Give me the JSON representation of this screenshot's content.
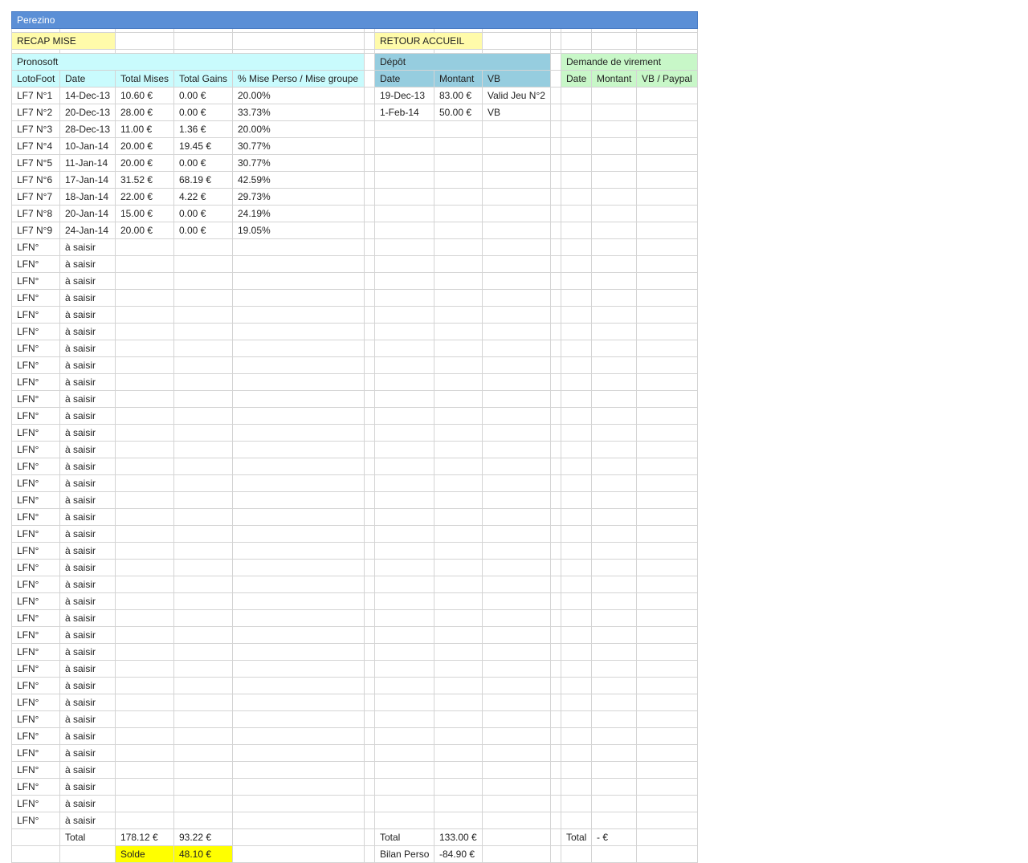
{
  "sheet_title": "Perezino",
  "buttons": {
    "recap": "RECAP MISE",
    "retour": "RETOUR ACCUEIL"
  },
  "sections": {
    "pronosoft": "Pronosoft",
    "depot": "Dépôt",
    "virement": "Demande de virement"
  },
  "columns": {
    "pronosoft": [
      "LotoFoot",
      "Date",
      "Total Mises",
      "Total Gains",
      "% Mise Perso / Mise groupe"
    ],
    "depot": [
      "Date",
      "Montant",
      "VB"
    ],
    "virement": [
      "Date",
      "Montant",
      "VB / Paypal"
    ]
  },
  "pronosoft_rows": [
    [
      "LF7 N°1",
      "14-Dec-13",
      "10.60 €",
      "0.00 €",
      "20.00%"
    ],
    [
      "LF7 N°2",
      "20-Dec-13",
      "28.00 €",
      "0.00 €",
      "33.73%"
    ],
    [
      "LF7 N°3",
      "28-Dec-13",
      "11.00 €",
      "1.36 €",
      "20.00%"
    ],
    [
      "LF7 N°4",
      "10-Jan-14",
      "20.00 €",
      "19.45 €",
      "30.77%"
    ],
    [
      "LF7 N°5",
      "11-Jan-14",
      "20.00 €",
      "0.00 €",
      "30.77%"
    ],
    [
      "LF7 N°6",
      "17-Jan-14",
      "31.52 €",
      "68.19 €",
      "42.59%"
    ],
    [
      "LF7 N°7",
      "18-Jan-14",
      "22.00 €",
      "4.22 €",
      "29.73%"
    ],
    [
      "LF7 N°8",
      "20-Jan-14",
      "15.00 €",
      "0.00 €",
      "24.19%"
    ],
    [
      "LF7 N°9",
      "24-Jan-14",
      "20.00 €",
      "0.00 €",
      "19.05%"
    ],
    [
      "LFN°",
      "à saisir",
      "",
      "",
      ""
    ],
    [
      "LFN°",
      "à saisir",
      "",
      "",
      ""
    ],
    [
      "LFN°",
      "à saisir",
      "",
      "",
      ""
    ],
    [
      "LFN°",
      "à saisir",
      "",
      "",
      ""
    ],
    [
      "LFN°",
      "à saisir",
      "",
      "",
      ""
    ],
    [
      "LFN°",
      "à saisir",
      "",
      "",
      ""
    ],
    [
      "LFN°",
      "à saisir",
      "",
      "",
      ""
    ],
    [
      "LFN°",
      "à saisir",
      "",
      "",
      ""
    ],
    [
      "LFN°",
      "à saisir",
      "",
      "",
      ""
    ],
    [
      "LFN°",
      "à saisir",
      "",
      "",
      ""
    ],
    [
      "LFN°",
      "à saisir",
      "",
      "",
      ""
    ],
    [
      "LFN°",
      "à saisir",
      "",
      "",
      ""
    ],
    [
      "LFN°",
      "à saisir",
      "",
      "",
      ""
    ],
    [
      "LFN°",
      "à saisir",
      "",
      "",
      ""
    ],
    [
      "LFN°",
      "à saisir",
      "",
      "",
      ""
    ],
    [
      "LFN°",
      "à saisir",
      "",
      "",
      ""
    ],
    [
      "LFN°",
      "à saisir",
      "",
      "",
      ""
    ],
    [
      "LFN°",
      "à saisir",
      "",
      "",
      ""
    ],
    [
      "LFN°",
      "à saisir",
      "",
      "",
      ""
    ],
    [
      "LFN°",
      "à saisir",
      "",
      "",
      ""
    ],
    [
      "LFN°",
      "à saisir",
      "",
      "",
      ""
    ],
    [
      "LFN°",
      "à saisir",
      "",
      "",
      ""
    ],
    [
      "LFN°",
      "à saisir",
      "",
      "",
      ""
    ],
    [
      "LFN°",
      "à saisir",
      "",
      "",
      ""
    ],
    [
      "LFN°",
      "à saisir",
      "",
      "",
      ""
    ],
    [
      "LFN°",
      "à saisir",
      "",
      "",
      ""
    ],
    [
      "LFN°",
      "à saisir",
      "",
      "",
      ""
    ],
    [
      "LFN°",
      "à saisir",
      "",
      "",
      ""
    ],
    [
      "LFN°",
      "à saisir",
      "",
      "",
      ""
    ],
    [
      "LFN°",
      "à saisir",
      "",
      "",
      ""
    ],
    [
      "LFN°",
      "à saisir",
      "",
      "",
      ""
    ],
    [
      "LFN°",
      "à saisir",
      "",
      "",
      ""
    ],
    [
      "LFN°",
      "à saisir",
      "",
      "",
      ""
    ],
    [
      "LFN°",
      "à saisir",
      "",
      "",
      ""
    ],
    [
      "LFN°",
      "à saisir",
      "",
      "",
      ""
    ]
  ],
  "depot_rows": [
    [
      "19-Dec-13",
      "83.00 €",
      "Valid Jeu N°2"
    ],
    [
      "1-Feb-14",
      "50.00 €",
      "VB"
    ]
  ],
  "virement_rows": [],
  "totals": {
    "total_label": "Total",
    "total_mises": "178.12 €",
    "total_gains": "93.22 €",
    "depot_total_label": "Total",
    "depot_total": "133.00 €",
    "virement_total_label": "Total",
    "virement_total": "- €"
  },
  "solde": {
    "label": "Solde",
    "value": "48.10 €",
    "bilan_label": "Bilan Perso",
    "bilan_value": "-84.90 €"
  },
  "colors": {
    "title_bar": "#5b8fd6",
    "yellow_soft": "#fffbaa",
    "yellow": "#ffff00",
    "cyan_head": "#c9fbfd",
    "teal_head": "#96cddf",
    "green_head": "#c8f7c8"
  }
}
